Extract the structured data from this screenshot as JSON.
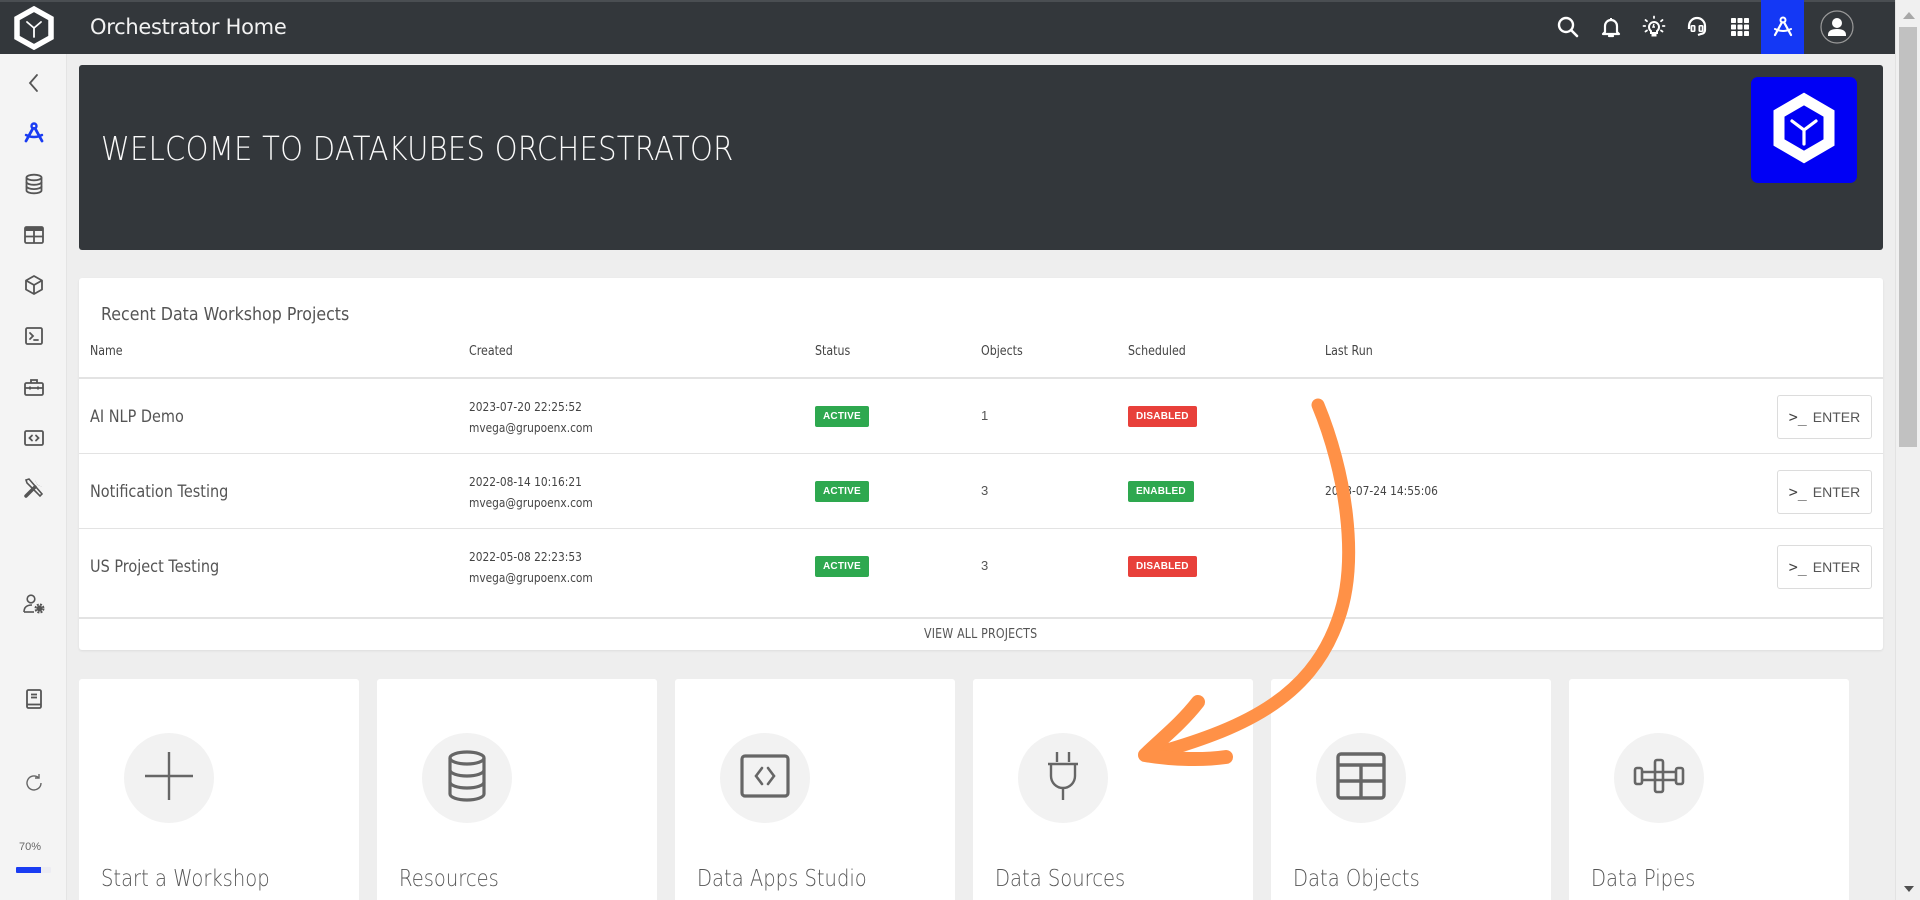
{
  "topbar": {
    "title": "Orchestrator Home",
    "icons": [
      "search-icon",
      "bell-icon",
      "lightbulb-icon",
      "headset-icon",
      "apps-grid-icon",
      "compass-drafting-icon",
      "user-avatar-icon"
    ],
    "active_icon": "compass-drafting-icon"
  },
  "sidebar": {
    "items": [
      {
        "name": "collapse",
        "icon": "chevron-left-icon"
      },
      {
        "name": "data-workshop",
        "icon": "compass-drafting-icon",
        "active": true
      },
      {
        "name": "resources",
        "icon": "database-icon"
      },
      {
        "name": "data-objects",
        "icon": "table-icon"
      },
      {
        "name": "packages",
        "icon": "cube-icon"
      },
      {
        "name": "terminal",
        "icon": "terminal-icon"
      },
      {
        "name": "toolbox",
        "icon": "toolbox-icon"
      },
      {
        "name": "data-apps",
        "icon": "code-icon"
      },
      {
        "name": "tools",
        "icon": "tools-icon"
      },
      {
        "name": "user-settings",
        "icon": "user-gear-icon"
      },
      {
        "name": "documentation",
        "icon": "book-icon"
      },
      {
        "name": "refresh",
        "icon": "refresh-icon"
      }
    ],
    "zoom_label": "70%",
    "zoom_progress": 0.7
  },
  "banner": {
    "heading": "WELCOME TO DATAKUBES ORCHESTRATOR"
  },
  "projects": {
    "title": "Recent Data Workshop Projects",
    "columns": [
      "Name",
      "Created",
      "Status",
      "Objects",
      "Scheduled",
      "Last Run"
    ],
    "rows": [
      {
        "name": "AI NLP Demo",
        "created_date": "2023-07-20 22:25:52",
        "created_by": "mvega@grupoenx.com",
        "status": "ACTIVE",
        "objects": "1",
        "scheduled": "DISABLED",
        "last_run": "",
        "action": "ENTER"
      },
      {
        "name": "Notification Testing",
        "created_date": "2022-08-14 10:16:21",
        "created_by": "mvega@grupoenx.com",
        "status": "ACTIVE",
        "objects": "3",
        "scheduled": "ENABLED",
        "last_run": "2023-07-24 14:55:06",
        "action": "ENTER"
      },
      {
        "name": "US Project Testing",
        "created_date": "2022-05-08 22:23:53",
        "created_by": "mvega@grupoenx.com",
        "status": "ACTIVE",
        "objects": "3",
        "scheduled": "DISABLED",
        "last_run": "",
        "action": "ENTER"
      }
    ],
    "view_all_label": "VIEW ALL PROJECTS",
    "enter_prompt": ">_"
  },
  "tiles": [
    {
      "label": "Start a Workshop",
      "icon": "plus-icon"
    },
    {
      "label": "Resources",
      "icon": "database-icon"
    },
    {
      "label": "Data Apps Studio",
      "icon": "code-icon"
    },
    {
      "label": "Data Sources",
      "icon": "plug-icon"
    },
    {
      "label": "Data Objects",
      "icon": "table-icon"
    },
    {
      "label": "Data Pipes",
      "icon": "pipe-icon"
    }
  ],
  "colors": {
    "topbar_bg": "#33373b",
    "accent_blue": "#1438f5",
    "brand_blue": "#0000f5",
    "badge_green": "#2ea84f",
    "badge_red": "#e8403a",
    "annotation_orange": "#ff9147"
  }
}
